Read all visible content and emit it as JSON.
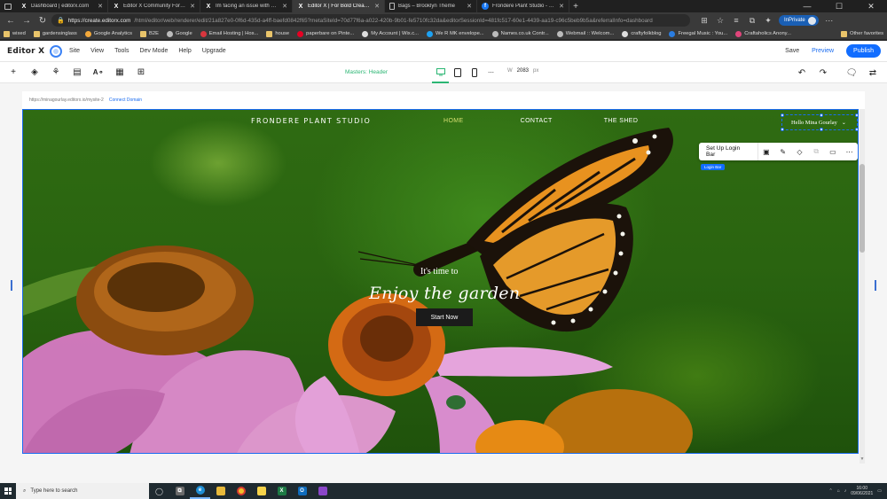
{
  "browser": {
    "tabs": [
      {
        "label": "Dashboard | editorx.com",
        "icon": "editorx-icon",
        "active": false
      },
      {
        "label": "Editor X Community Forum | Coi",
        "icon": "editorx-icon",
        "active": false
      },
      {
        "label": "Im facing an issue with shop ver",
        "icon": "editorx-icon",
        "active": false
      },
      {
        "label": "Editor X | For Bold Creators",
        "icon": "editorx-icon",
        "active": true
      },
      {
        "label": "Bags – Brooklyn Theme",
        "icon": "page-icon",
        "active": false
      },
      {
        "label": "Frondere Plant Studio - Home | ",
        "icon": "facebook-icon",
        "active": false
      }
    ],
    "url_host": "https://create.editorx.com",
    "url_path": "/html/editor/web/renderer/edit/21a827e0-0f6d-435d-a4ff-baefd0842f65?metaSiteId=70d77f6a-a022-420b-9b01-fe5710fc32da&editorSessionId=481fc517-60e1-4439-aa19-c96c5beb9b5a&referralInfo=dashboard",
    "inprivate_label": "InPrivate",
    "bookmarks": [
      {
        "label": "wixed",
        "color": "#e9c46a"
      },
      {
        "label": "gardensinglass",
        "color": "#e9c46a"
      },
      {
        "label": "Google Analytics",
        "color": "#f4a93b"
      },
      {
        "label": "B2E",
        "color": "#e9c46a"
      },
      {
        "label": "Google",
        "color": "#bbbbbb"
      },
      {
        "label": "Email Hosting | Hos...",
        "color": "#d9363e"
      },
      {
        "label": "house",
        "color": "#e9c46a"
      },
      {
        "label": "paperbare on Pinte...",
        "color": "#e60023"
      },
      {
        "label": "My Account | Wix.c...",
        "color": "#dddddd"
      },
      {
        "label": "We R MK envelope...",
        "color": "#1da1f2"
      },
      {
        "label": "Names.co.uk Contr...",
        "color": "#bbbbbb"
      },
      {
        "label": "Webmail :: Welcom...",
        "color": "#bbbbbb"
      },
      {
        "label": "craftyfolkblog",
        "color": "#dddddd"
      },
      {
        "label": "Freegal Music : You...",
        "color": "#2a7de1"
      },
      {
        "label": "Craftaholics Anony...",
        "color": "#e0457b"
      }
    ],
    "other_favorites": "Other favorites"
  },
  "editor": {
    "logo": "Editor X",
    "menu": [
      "Site",
      "View",
      "Tools",
      "Dev Mode",
      "Help",
      "Upgrade"
    ],
    "save": "Save",
    "preview": "Preview",
    "publish": "Publish",
    "masters_label": "Masters:  Header",
    "width_label": "W",
    "width_value": "2083",
    "width_unit": "px",
    "site_url": "https://minagourlay.editorx.io/mysite-2",
    "connect_domain": "Connect Domain"
  },
  "site": {
    "title": "FRONDERE PLANT STUDIO",
    "nav": [
      "HOME",
      "CONTACT",
      "THE SHED"
    ],
    "login_text": "Hello Mina Gourlay",
    "hero_sub": "It's time to",
    "hero_main": "Enjoy the garden",
    "cta": "Start Now"
  },
  "floating_toolbar": {
    "setup_label": "Set Up Login Bar",
    "tag": "Login Bar"
  },
  "taskbar": {
    "search_placeholder": "Type here to search",
    "time": "16:00",
    "date": "09/06/2021"
  },
  "colors": {
    "accent": "#116dff",
    "masters_green": "#2bb673",
    "nav_active": "#d7df71"
  }
}
